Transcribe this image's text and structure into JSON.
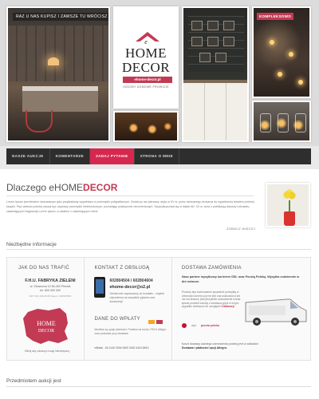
{
  "hero": {
    "banner_text": "RAZ U NAS KUPISZ I ZAWSZE TU WRÓCISZ",
    "logo": {
      "e": "e",
      "home": "HOME",
      "decor": "DECOR",
      "url": "ehome-decor.pl",
      "tagline": "OZDOBY DOMOWE PROWIZJE"
    },
    "tag": "KOMPLEKSOWO"
  },
  "nav": {
    "items": [
      {
        "label": "NASZE AUKCJE",
        "active": false
      },
      {
        "label": "KOMENTARZE",
        "active": false
      },
      {
        "label": "ZADAJ PYTANIE",
        "active": true
      },
      {
        "label": "STRONA O MNIE",
        "active": false
      }
    ]
  },
  "main": {
    "headline_prefix": "Dlaczego e",
    "headline_home": "HOME",
    "headline_brand": "DECOR",
    "lorem": "Lorem Ipsum jest tekstem stosowanym jako przykładowy wypełniacz w przemyśle poligraficznym. Został po raz pierwszy użyty w XV w. przez nieznanego drukarza do wypełnienia tekstem próbnej książki. Pięć wieków później zaczął być używany przemyśle elektronicznym, pozostając praktycznie niezmienionym. Spopularyzował się w latach 60. XX w. wraz z publikacją arkuszy Letrasetu, zawierających fragmenty Lorem Ipsum, a ostatnio z zawierającym różne",
    "more_link": "ZOBACZ WIĘCEJ",
    "section_title": "Niezbędne informacje",
    "bottom_title": "Przedmiotem aukcji jest"
  },
  "info": {
    "where": {
      "title": "JAK DO NAS TRAFIĆ",
      "company": "F.H.U. FABRYKA ZIELENI",
      "address_line1": "ul. Słowiczna 10 56-400 Pleśnik",
      "address_line2": "tel. 600 000 000",
      "nip": "NIP: 615-126-80-86 Regon: 020937803",
      "map_note": "Kliknij aby zobaczyć mapę interaktywną"
    },
    "contact": {
      "title": "KONTAKT Z OBSŁUGĄ",
      "phone1": "602804504",
      "phone2": "602804604",
      "email": "ehome-decor@o2.pl",
      "contact_text": "Serdecznie zapraszamy do kontaktu - chętnie odpowiemy na wszystkie pytania oraz doradzimy!",
      "pay_title": "DANE DO WPŁATY",
      "pay_text": "Możliwe są opcje płatności: Przelew na konto, PAYU Allegro oraz pobranie przy dostawie",
      "mbank": "mBank - 84 1140 2004 0000 3402 4424 8610"
    },
    "shipping": {
      "title": "DOSTAWA ZAMÓWIENIA",
      "bold_text": "Nasz partner wysyłkowy kurierem GSL oraz Pocztą Polską. Wysyłka codziennie w dni robocze.",
      "text_1": "Prosimy aby kurierowanie sprawdzić przesyłkę w obecności kuriera czy nie jest ona uszkodzona lub nie ma braków, jeśli jest jakieś uszkodzenie trzeba spisać protokół szkody z dostawcą gdyż w innym wypadku dostawca nie uwzględni ",
      "text_red": "reklamacji",
      "dpd": "dpd",
      "poczta": "poczta polska",
      "foot_1": "Koszt dostawy każdego zamówienia podany jest w zakładce",
      "foot_2": "Dostawa i płatności opcji Allegro."
    }
  },
  "colors": {
    "accent": "#c23a54",
    "nav_bg": "#2e2e2e",
    "nav_active": "#d6284f"
  }
}
